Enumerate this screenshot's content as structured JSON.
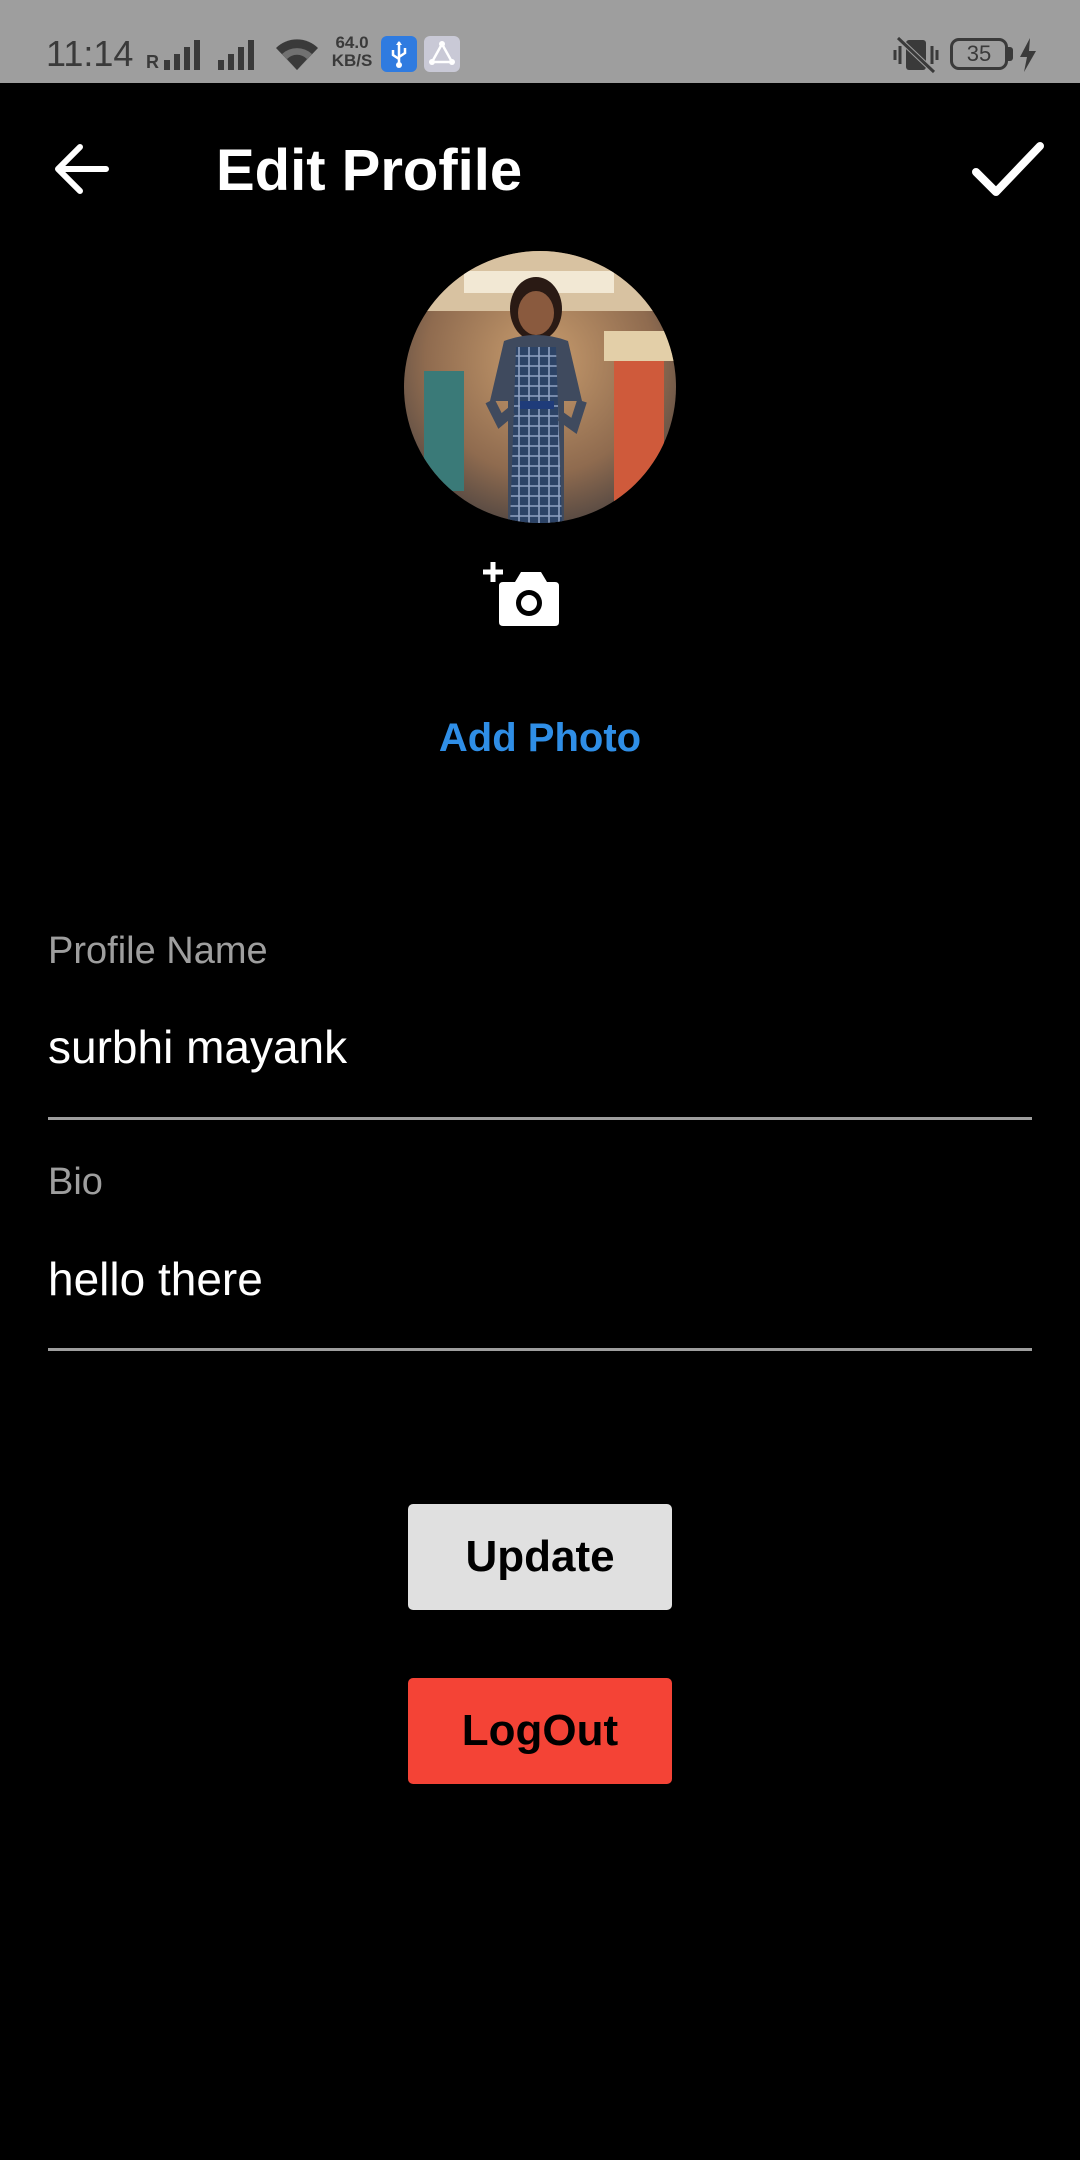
{
  "status_bar": {
    "time": "11:14",
    "network_speed_value": "64.0",
    "network_speed_unit": "KB/S",
    "battery_level": "35",
    "icons": [
      "signal-roaming-icon",
      "signal-icon",
      "wifi-icon",
      "usb-notification-icon",
      "app-notification-icon",
      "vibrate-icon",
      "battery-icon",
      "charging-icon"
    ]
  },
  "header": {
    "title": "Edit Profile",
    "back_icon": "arrow-left-icon",
    "confirm_icon": "checkmark-icon"
  },
  "avatar": {
    "add_photo_icon": "add-camera-icon",
    "add_photo_label": "Add Photo"
  },
  "form": {
    "profile_name_label": "Profile Name",
    "profile_name_value": "surbhi mayank",
    "bio_label": "Bio",
    "bio_value": "hello there"
  },
  "buttons": {
    "update_label": "Update",
    "logout_label": "LogOut"
  },
  "colors": {
    "background": "#000000",
    "status_bar": "#9e9e9e",
    "accent_link": "#2f8ee6",
    "update_button": "#e0e0e0",
    "logout_button": "#f44336",
    "underline": "#9e9e9e"
  }
}
